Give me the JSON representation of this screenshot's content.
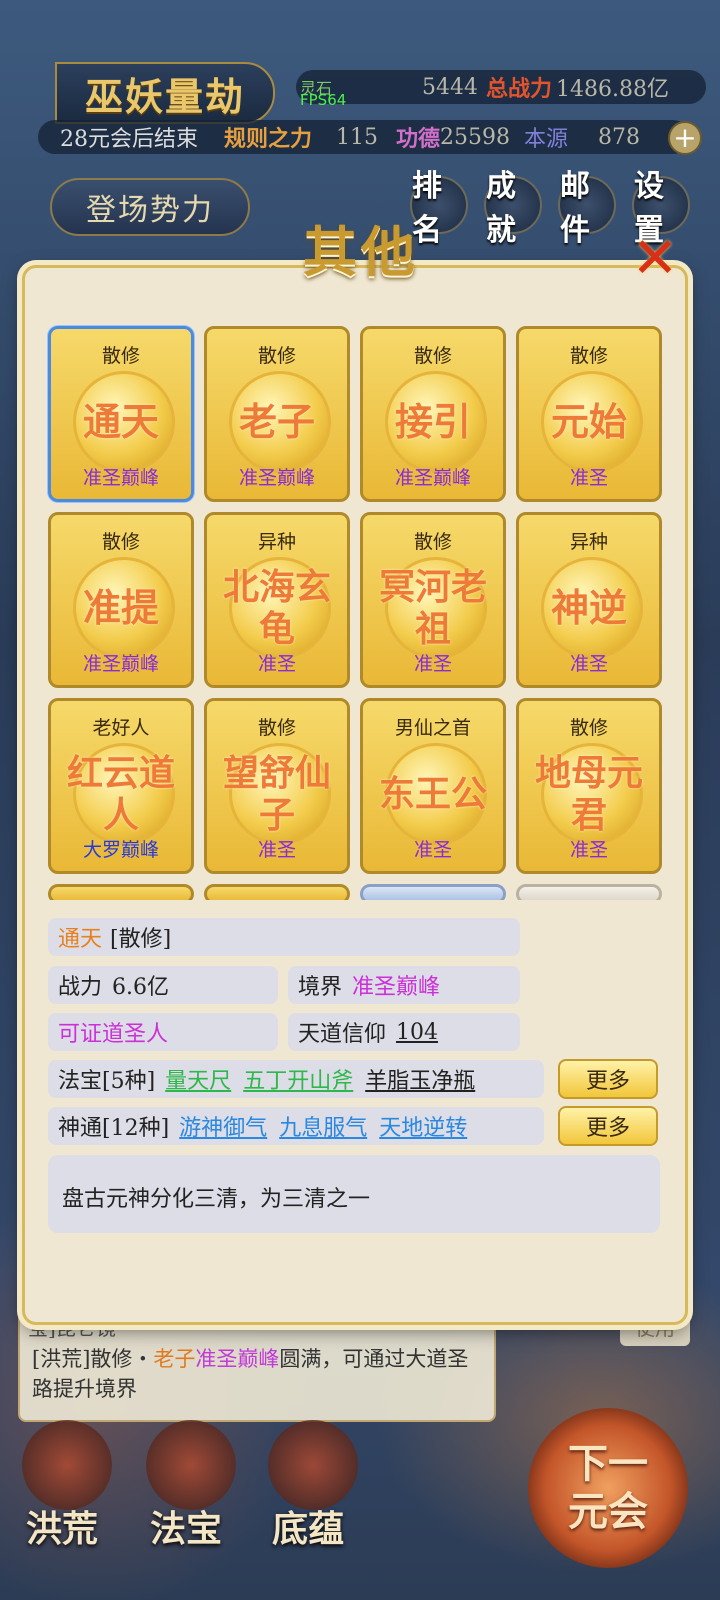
{
  "hud": {
    "title": "巫妖量劫",
    "lingshi_label": "灵石",
    "lingshi_value": "5444",
    "power_label": "总战力",
    "power_value": "1486.88亿",
    "fps": "FPS64",
    "countdown": "28元会后结束",
    "rule_label": "规则之力",
    "rule_value": "115",
    "merit_label": "功德",
    "merit_value": "25598",
    "origin_label": "本源",
    "origin_value": "878",
    "plus": "+",
    "faction_button": "登场势力",
    "top_buttons": [
      "排名",
      "成就",
      "邮件",
      "设置"
    ]
  },
  "modal": {
    "title": "其他",
    "close": "✕",
    "cards": [
      {
        "tag": "散修",
        "name": "通天",
        "rank": "准圣巅峰",
        "selected": true
      },
      {
        "tag": "散修",
        "name": "老子",
        "rank": "准圣巅峰"
      },
      {
        "tag": "散修",
        "name": "接引",
        "rank": "准圣巅峰"
      },
      {
        "tag": "散修",
        "name": "元始",
        "rank": "准圣"
      },
      {
        "tag": "散修",
        "name": "准提",
        "rank": "准圣巅峰"
      },
      {
        "tag": "异种",
        "name": "北海玄龟",
        "rank": "准圣"
      },
      {
        "tag": "散修",
        "name": "冥河老祖",
        "rank": "准圣"
      },
      {
        "tag": "异种",
        "name": "神逆",
        "rank": "准圣"
      },
      {
        "tag": "老好人",
        "name": "红云道人",
        "rank": "大罗巅峰",
        "rank_color": "blue"
      },
      {
        "tag": "散修",
        "name": "望舒仙子",
        "rank": "准圣"
      },
      {
        "tag": "男仙之首",
        "name": "东王公",
        "rank": "准圣"
      },
      {
        "tag": "散修",
        "name": "地母元君",
        "rank": "准圣"
      }
    ],
    "detail": {
      "name": "通天",
      "tag": "[散修]",
      "power_label": "战力",
      "power_value": "6.6亿",
      "realm_label": "境界",
      "realm_value": "准圣巅峰",
      "status": "可证道圣人",
      "faith_label": "天道信仰",
      "faith_value": "104",
      "treasure_label": "法宝[5种]",
      "treasures": [
        "量天尺",
        "五丁开山斧",
        "羊脂玉净瓶"
      ],
      "skill_label": "神通[12种]",
      "skills": [
        "游神御气",
        "九息服气",
        "天地逆转"
      ],
      "more_label": "更多",
      "description": "盘古元神分化三清，为三清之一"
    }
  },
  "bottom": {
    "message_top": "宝]昆仑镜",
    "message_prefix": "[洪荒]散修・",
    "message_name": "老子",
    "message_rank": "准圣巅峰",
    "message_suffix": "圆满，可通过大道圣路提升境界",
    "use_button": "使用",
    "nav": [
      "洪荒",
      "法宝",
      "底蕴"
    ],
    "next_button": "下一元会"
  },
  "colors": {
    "gold_border": "#d6b95a",
    "rank_purple": "#8a2ad8",
    "name_orange": "#ee7a38",
    "selected_border": "#4a8ae0"
  }
}
